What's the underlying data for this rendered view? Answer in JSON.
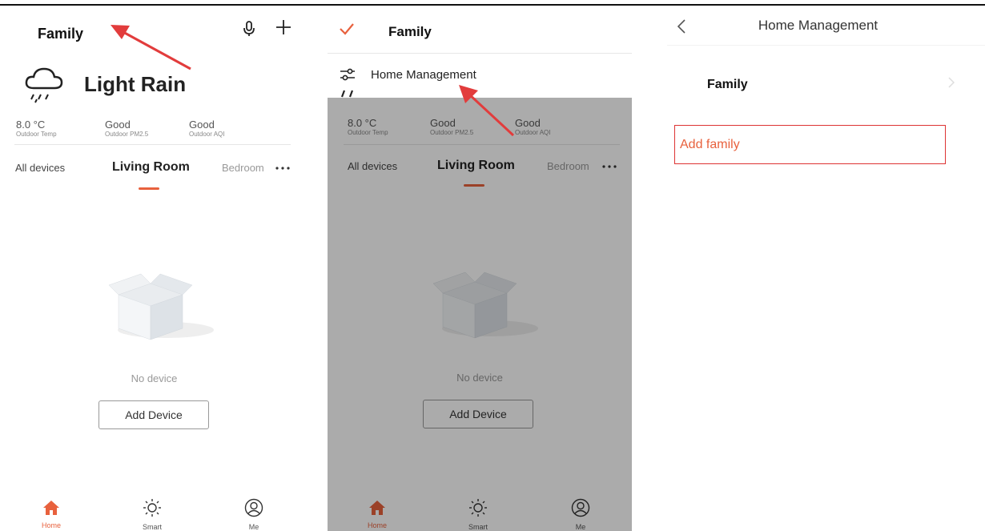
{
  "screen1": {
    "family_name": "Family",
    "weather": "Light Rain",
    "stats": [
      {
        "value": "8.0 °C",
        "label": "Outdoor Temp"
      },
      {
        "value": "Good",
        "label": "Outdoor PM2.5"
      },
      {
        "value": "Good",
        "label": "Outdoor AQI"
      }
    ],
    "tabs": [
      "All devices",
      "Living Room",
      "Bedroom"
    ],
    "empty_text": "No device",
    "add_device_label": "Add Device",
    "nav": [
      "Home",
      "Smart",
      "Me"
    ]
  },
  "screen2": {
    "family_name": "Family",
    "menu_item": "Home Management",
    "stats": [
      {
        "value": "8.0 °C",
        "label": "Outdoor Temp"
      },
      {
        "value": "Good",
        "label": "Outdoor PM2.5"
      },
      {
        "value": "Good",
        "label": "Outdoor AQI"
      }
    ],
    "tabs": [
      "All devices",
      "Living Room",
      "Bedroom"
    ],
    "empty_text": "No device",
    "add_device_label": "Add Device",
    "nav": [
      "Home",
      "Smart",
      "Me"
    ]
  },
  "screen3": {
    "title": "Home Management",
    "family_name": "Family",
    "add_family_label": "Add family"
  },
  "colors": {
    "accent": "#e8613d",
    "arrow": "#e23c3c",
    "highlight_border": "#dd3333"
  },
  "icons": {
    "dropdown": "chevron-down-icon",
    "voice": "microphone-icon",
    "add": "plus-icon",
    "weather": "rain-cloud-icon",
    "more": "more-dots-icon",
    "empty": "empty-box-icon",
    "home": "home-icon",
    "smart": "sun-icon",
    "me": "user-icon",
    "selected": "checkmark-icon",
    "manage": "sliders-icon",
    "back": "back-chevron-icon",
    "row_arrow": "chevron-right-icon"
  }
}
